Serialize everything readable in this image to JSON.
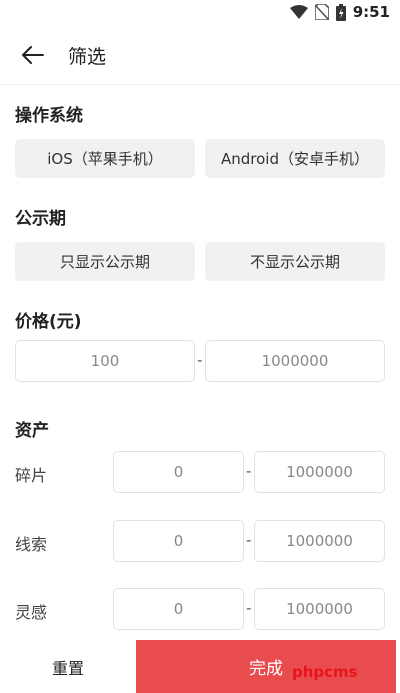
{
  "status_bar": {
    "time": "9:51",
    "icons": [
      "wifi-icon",
      "no-sim-icon",
      "battery-icon"
    ]
  },
  "header": {
    "back_icon": "arrow-left-icon",
    "title": "筛选"
  },
  "os_section": {
    "title": "操作系统",
    "options": [
      "iOS（苹果手机）",
      "Android（安卓手机）"
    ]
  },
  "publicity_section": {
    "title": "公示期",
    "options": [
      "只显示公示期",
      "不显示公示期"
    ]
  },
  "price_section": {
    "title": "价格(元)",
    "min": "100",
    "separator": "-",
    "max": "1000000"
  },
  "assets_section": {
    "title": "资产",
    "rows": [
      {
        "label": "碎片",
        "min": "0",
        "separator": "-",
        "max": "1000000"
      },
      {
        "label": "线索",
        "min": "0",
        "separator": "-",
        "max": "1000000"
      },
      {
        "label": "灵感",
        "min": "0",
        "separator": "-",
        "max": "1000000"
      }
    ]
  },
  "footer": {
    "reset_label": "重置",
    "done_label": "完成"
  },
  "watermark": "phpcms",
  "colors": {
    "accent": "#e84c4f",
    "chip_bg": "#f1f1f1",
    "border": "#e2e2e2"
  }
}
